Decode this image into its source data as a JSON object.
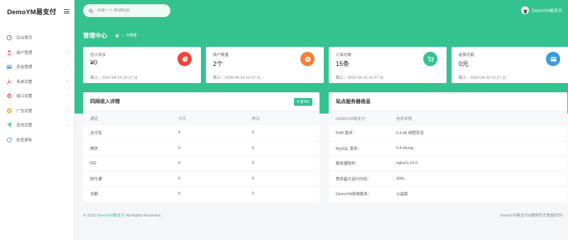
{
  "app": {
    "brand": "DemoYM易支付"
  },
  "sidebar": {
    "items": [
      {
        "label": "后台首页",
        "icon": "dashboard-icon",
        "color": "#6c7a91",
        "caret": ""
      },
      {
        "label": "商户管理",
        "icon": "users-icon",
        "color": "#f46a6a",
        "caret": "›"
      },
      {
        "label": "资金管理",
        "icon": "wallet-icon",
        "color": "#50a5f1",
        "caret": "›"
      },
      {
        "label": "系统设置",
        "icon": "settings-icon",
        "color": "#f46a6a",
        "caret": "›"
      },
      {
        "label": "接口设置",
        "icon": "plug-icon",
        "color": "#f46a6a",
        "caret": "›"
      },
      {
        "label": "广告设置",
        "icon": "megaphone-icon",
        "color": "#f1b44c",
        "caret": "›"
      },
      {
        "label": "其他设置",
        "icon": "send-icon",
        "color": "#34c38f",
        "caret": "›"
      },
      {
        "label": "检查更新",
        "icon": "refresh-icon",
        "color": "#50a5f1",
        "caret": ""
      }
    ]
  },
  "header": {
    "search_placeholder": "百度一下,你就知道",
    "user_name": "DemoYM易支付",
    "page_title": "管理中心",
    "breadcrumb": "仪表盘"
  },
  "colors": {
    "accent": "#34c38f"
  },
  "cards": [
    {
      "label": "总计流水",
      "value": "¥0",
      "time": "截止：2020-04-26 10:27:11",
      "icon": "pie-chart-icon",
      "color": "#f0433a"
    },
    {
      "label": "商户数量",
      "value": "2个",
      "time": "截止：2020-04-26 10:27:11",
      "icon": "coin-icon",
      "color": "#f1803a"
    },
    {
      "label": "订单总数",
      "value": "15条",
      "time": "截止：2020-04-26 10:27:11",
      "icon": "cart-icon",
      "color": "#34c38f"
    },
    {
      "label": "结算总额",
      "value": "0元",
      "time": "截止：2020-04-26 10:27:11",
      "icon": "card-icon",
      "color": "#3a9bdc"
    }
  ],
  "income": {
    "title": "四网收入详情",
    "badge": "9 变中E",
    "columns": [
      "通道",
      "今日",
      "昨日"
    ],
    "rows": [
      [
        "支付宝",
        "0",
        "0"
      ],
      [
        "微信",
        "0",
        "0"
      ],
      [
        "QQ",
        "0",
        "0"
      ],
      [
        "财付通",
        "0",
        "0"
      ],
      [
        "总额",
        "0",
        "0"
      ]
    ]
  },
  "server": {
    "title": "站点服务器信息",
    "columns": [
      "DEMOYM易支付",
      "信息详情"
    ],
    "rows": [
      [
        "PHP 版本：",
        "5.6.40 线程安全"
      ],
      [
        "MySQL 版本：",
        "5.6.44-log"
      ],
      [
        "服务器软件：",
        "nginx/1.16.0"
      ],
      [
        "程序最大运行时间：",
        "300s"
      ],
      [
        "DemoYM系统版本：",
        "公益版"
      ]
    ]
  },
  "footer": {
    "copyright": "© 2020",
    "brand": "DemoYM易支付",
    "rights": "All Rights Reserved.",
    "right_text": "DemoYM易支付&懂你的才是最好的!"
  }
}
